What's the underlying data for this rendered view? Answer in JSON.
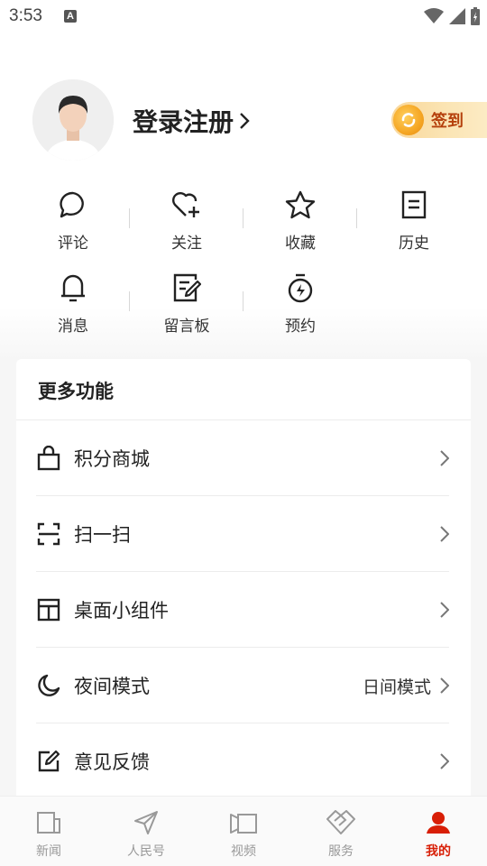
{
  "status_bar": {
    "time": "3:53",
    "notification_letter": "A"
  },
  "profile": {
    "login_label": "登录注册",
    "checkin_label": "签到"
  },
  "quick_actions": [
    {
      "label": "评论",
      "icon": "comment-icon"
    },
    {
      "label": "关注",
      "icon": "heart-plus-icon"
    },
    {
      "label": "收藏",
      "icon": "star-icon"
    },
    {
      "label": "历史",
      "icon": "history-doc-icon"
    },
    {
      "label": "消息",
      "icon": "bell-icon"
    },
    {
      "label": "留言板",
      "icon": "edit-note-icon"
    },
    {
      "label": "预约",
      "icon": "timer-icon"
    }
  ],
  "more": {
    "title": "更多功能",
    "items": [
      {
        "label": "积分商城",
        "icon": "shopping-bag-icon",
        "value": ""
      },
      {
        "label": "扫一扫",
        "icon": "scan-icon",
        "value": ""
      },
      {
        "label": "桌面小组件",
        "icon": "widget-icon",
        "value": ""
      },
      {
        "label": "夜间模式",
        "icon": "moon-icon",
        "value": "日间模式"
      },
      {
        "label": "意见反馈",
        "icon": "feedback-icon",
        "value": ""
      }
    ]
  },
  "bottom_nav": [
    {
      "label": "新闻",
      "icon": "news-icon",
      "active": false
    },
    {
      "label": "人民号",
      "icon": "send-icon",
      "active": false
    },
    {
      "label": "视频",
      "icon": "video-icon",
      "active": false
    },
    {
      "label": "服务",
      "icon": "service-icon",
      "active": false
    },
    {
      "label": "我的",
      "icon": "profile-icon",
      "active": true
    }
  ],
  "colors": {
    "accent": "#d81e06",
    "checkin_text": "#b5400c",
    "background": "#f6f6f6"
  }
}
